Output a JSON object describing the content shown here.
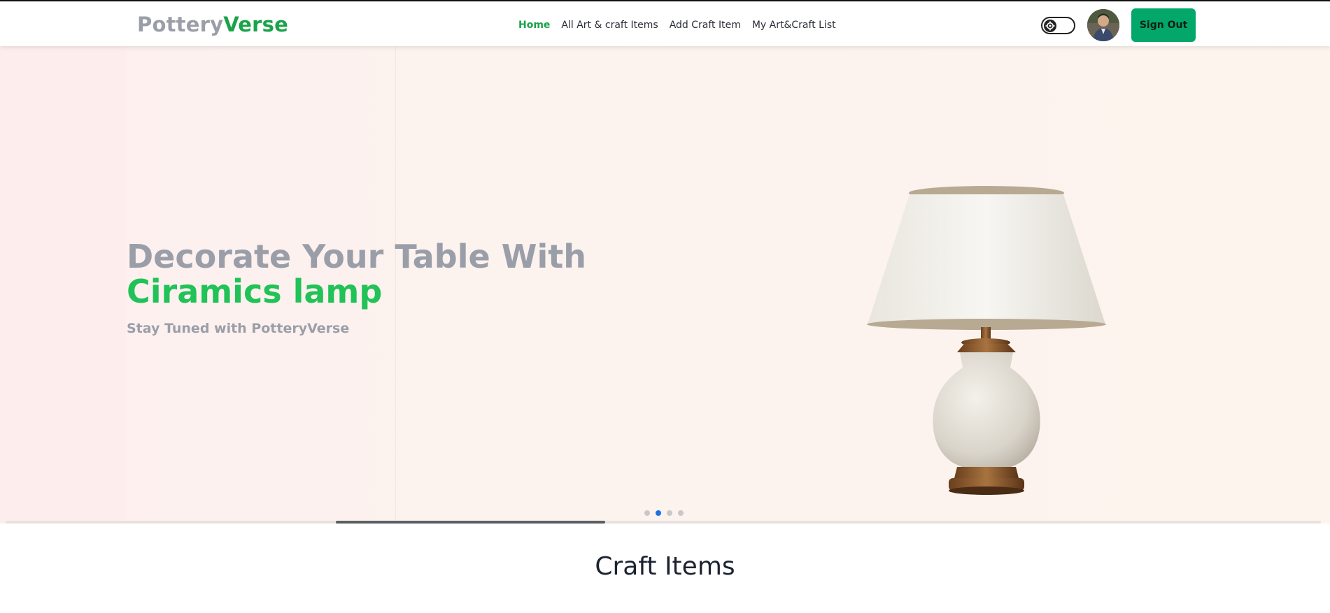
{
  "navbar": {
    "logo_part1": "Pottery",
    "logo_part2": "Verse",
    "links": [
      {
        "label": "Home",
        "active": true
      },
      {
        "label": "All Art & craft Items",
        "active": false
      },
      {
        "label": "Add Craft Item",
        "active": false
      },
      {
        "label": "My Art&Craft List",
        "active": false
      }
    ],
    "theme_toggle_icon": "gear-icon",
    "avatar_icon": "user-avatar",
    "signout_label": "Sign Out"
  },
  "hero": {
    "heading_line1": "Decorate Your Table With",
    "heading_line2": "Ciramics lamp",
    "subtitle": "Stay Tuned with PotteryVerse",
    "image_icon": "ceramic-lamp-image",
    "slides_total": 4,
    "active_slide": 2,
    "progress_fraction": 0.205
  },
  "section": {
    "title": "Craft Items"
  },
  "colors": {
    "brand_green": "#1aa34a",
    "hero_green": "#21c257",
    "signout_bg": "#03a76a",
    "muted_gray": "#9a9ea8",
    "active_dot": "#1b73e8"
  }
}
